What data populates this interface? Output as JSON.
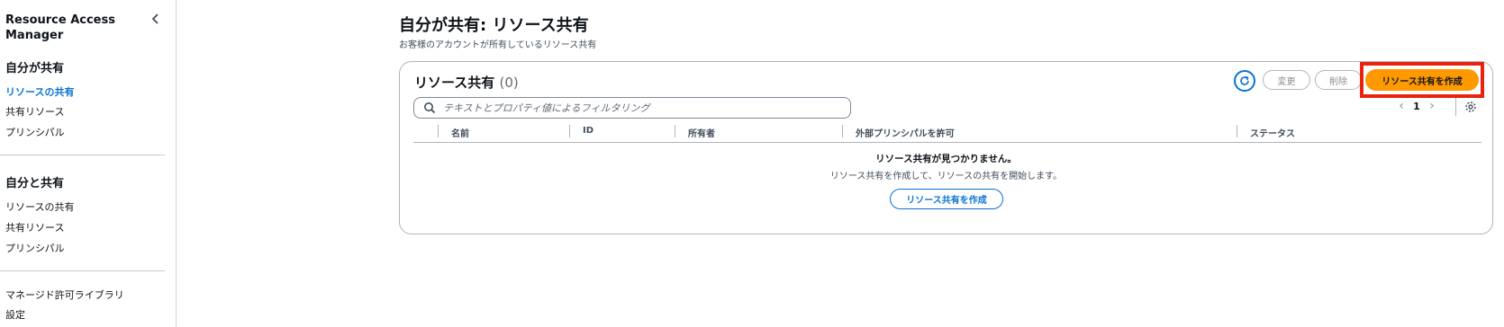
{
  "sidebar": {
    "title": "Resource Access Manager",
    "section1": {
      "heading": "自分が共有",
      "items": [
        "リソースの共有",
        "共有リソース",
        "プリンシパル"
      ]
    },
    "section2": {
      "heading": "自分と共有",
      "items": [
        "リソースの共有",
        "共有リソース",
        "プリンシパル"
      ]
    },
    "footer_items": [
      "マネージド許可ライブラリ",
      "設定"
    ]
  },
  "page": {
    "title": "自分が共有: リソース共有",
    "subtitle": "お客様のアカウントが所有しているリソース共有"
  },
  "panel": {
    "title": "リソース共有",
    "count": "(0)",
    "edit_label": "変更",
    "delete_label": "削除",
    "create_label": "リソース共有を作成",
    "search_placeholder": "テキストとプロパティ値によるフィルタリング",
    "page_number": "1",
    "columns": [
      "名前",
      "ID",
      "所有者",
      "外部プリンシパルを許可",
      "ステータス"
    ],
    "empty_title": "リソース共有が見つかりません。",
    "empty_sub": "リソース共有を作成して、リソースの共有を開始します。",
    "empty_create_label": "リソース共有を作成"
  },
  "colors": {
    "accent": "#0972d3",
    "primary_button": "#ff9900",
    "highlight": "#e8230f"
  }
}
